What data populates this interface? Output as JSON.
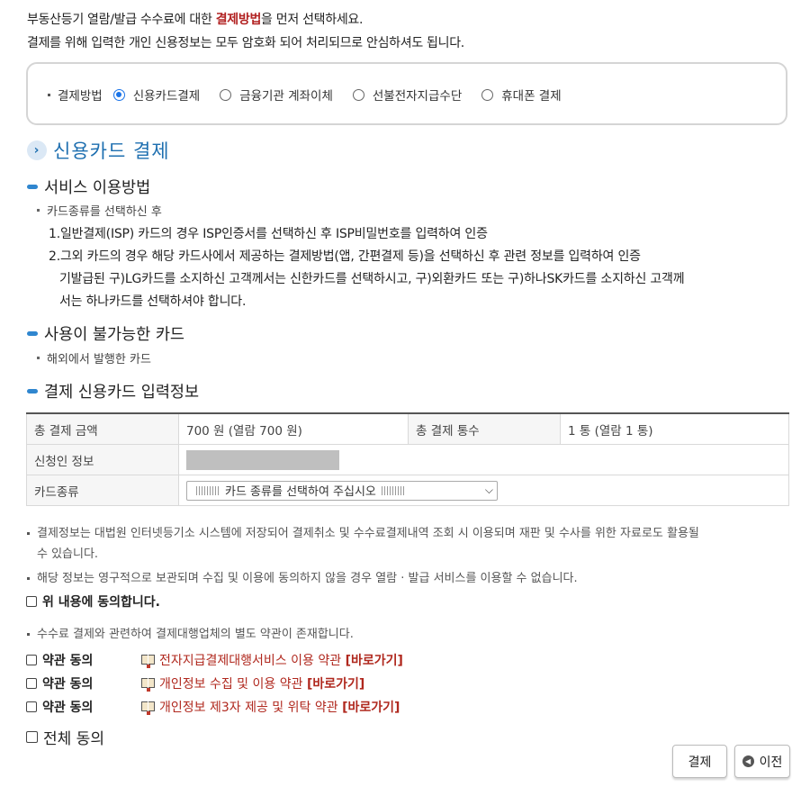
{
  "intro": {
    "line1_pre": "부동산등기 열람/발급 수수료에 대한 ",
    "line1_hl": "결제방법",
    "line1_post": "을 먼저 선택하세요.",
    "line2": "결제를 위해 입력한 개인 신용정보는 모두 암호화 되어 처리되므로 안심하셔도 됩니다."
  },
  "payment_method": {
    "label": "결제방법",
    "options": [
      {
        "label": "신용카드결제",
        "selected": true
      },
      {
        "label": "금융기관 계좌이체",
        "selected": false
      },
      {
        "label": "선불전자지급수단",
        "selected": false
      },
      {
        "label": "휴대폰 결제",
        "selected": false
      }
    ]
  },
  "section_title": "신용카드 결제",
  "usage": {
    "heading": "서비스 이용방법",
    "bullet": "카드종류를 선택하신 후",
    "item1": "1.일반결제(ISP) 카드의 경우 ISP인증서를 선택하신 후 ISP비밀번호를 입력하여 인증",
    "item2": "2.그외 카드의 경우 해당 카드사에서 제공하는 결제방법(앱, 간편결제 등)을 선택하신 후 관련 정보를 입력하여 인증",
    "item3a": "기발급된 구)LG카드를 소지하신 고객께서는 신한카드를 선택하시고, 구)외환카드 또는 구)하나SK카드를 소지하신 고객께",
    "item3b": "서는 하나카드를 선택하셔야 합니다."
  },
  "unusable": {
    "heading": "사용이 불가능한 카드",
    "bullet": "해외에서 발행한 카드"
  },
  "card_info": {
    "heading": "결제 신용카드 입력정보",
    "total_amount_label": "총 결제 금액",
    "total_amount_value": "700 원 (열람 700 원)",
    "total_count_label": "총 결제 통수",
    "total_count_value": "1 통 (열람 1 통)",
    "applicant_label": "신청인 정보",
    "card_type_label": "카드종류",
    "card_type_placeholder": "카드 종류를 선택하여 주십시오"
  },
  "notes": {
    "note1a": "결제정보는 대법원 인터넷등기소 시스템에 저장되어 결제취소 및 수수료결제내역 조회 시 이용되며 재판 및 수사를 위한 자료로도 활용될",
    "note1b": "수 있습니다.",
    "note2": "해당 정보는 영구적으로 보관되며 수집 및 이용에 동의하지 않을 경우 열람 · 발급 서비스를 이용할 수 없습니다.",
    "agree_above": "위 내용에 동의합니다.",
    "note3": "수수료 결제와 관련하여 결제대행업체의 별도 약관이 존재합니다."
  },
  "terms": [
    {
      "label": "약관 동의",
      "title": "전자지급결제대행서비스 이용 약관",
      "link": "[바로가기]"
    },
    {
      "label": "약관 동의",
      "title": "개인정보 수집 및 이용 약관",
      "link": "[바로가기]"
    },
    {
      "label": "약관 동의",
      "title": "개인정보 제3자 제공 및 위탁 약관",
      "link": "[바로가기]"
    }
  ],
  "agree_all": "전체 동의",
  "buttons": {
    "pay": "결제",
    "prev": "이전"
  }
}
